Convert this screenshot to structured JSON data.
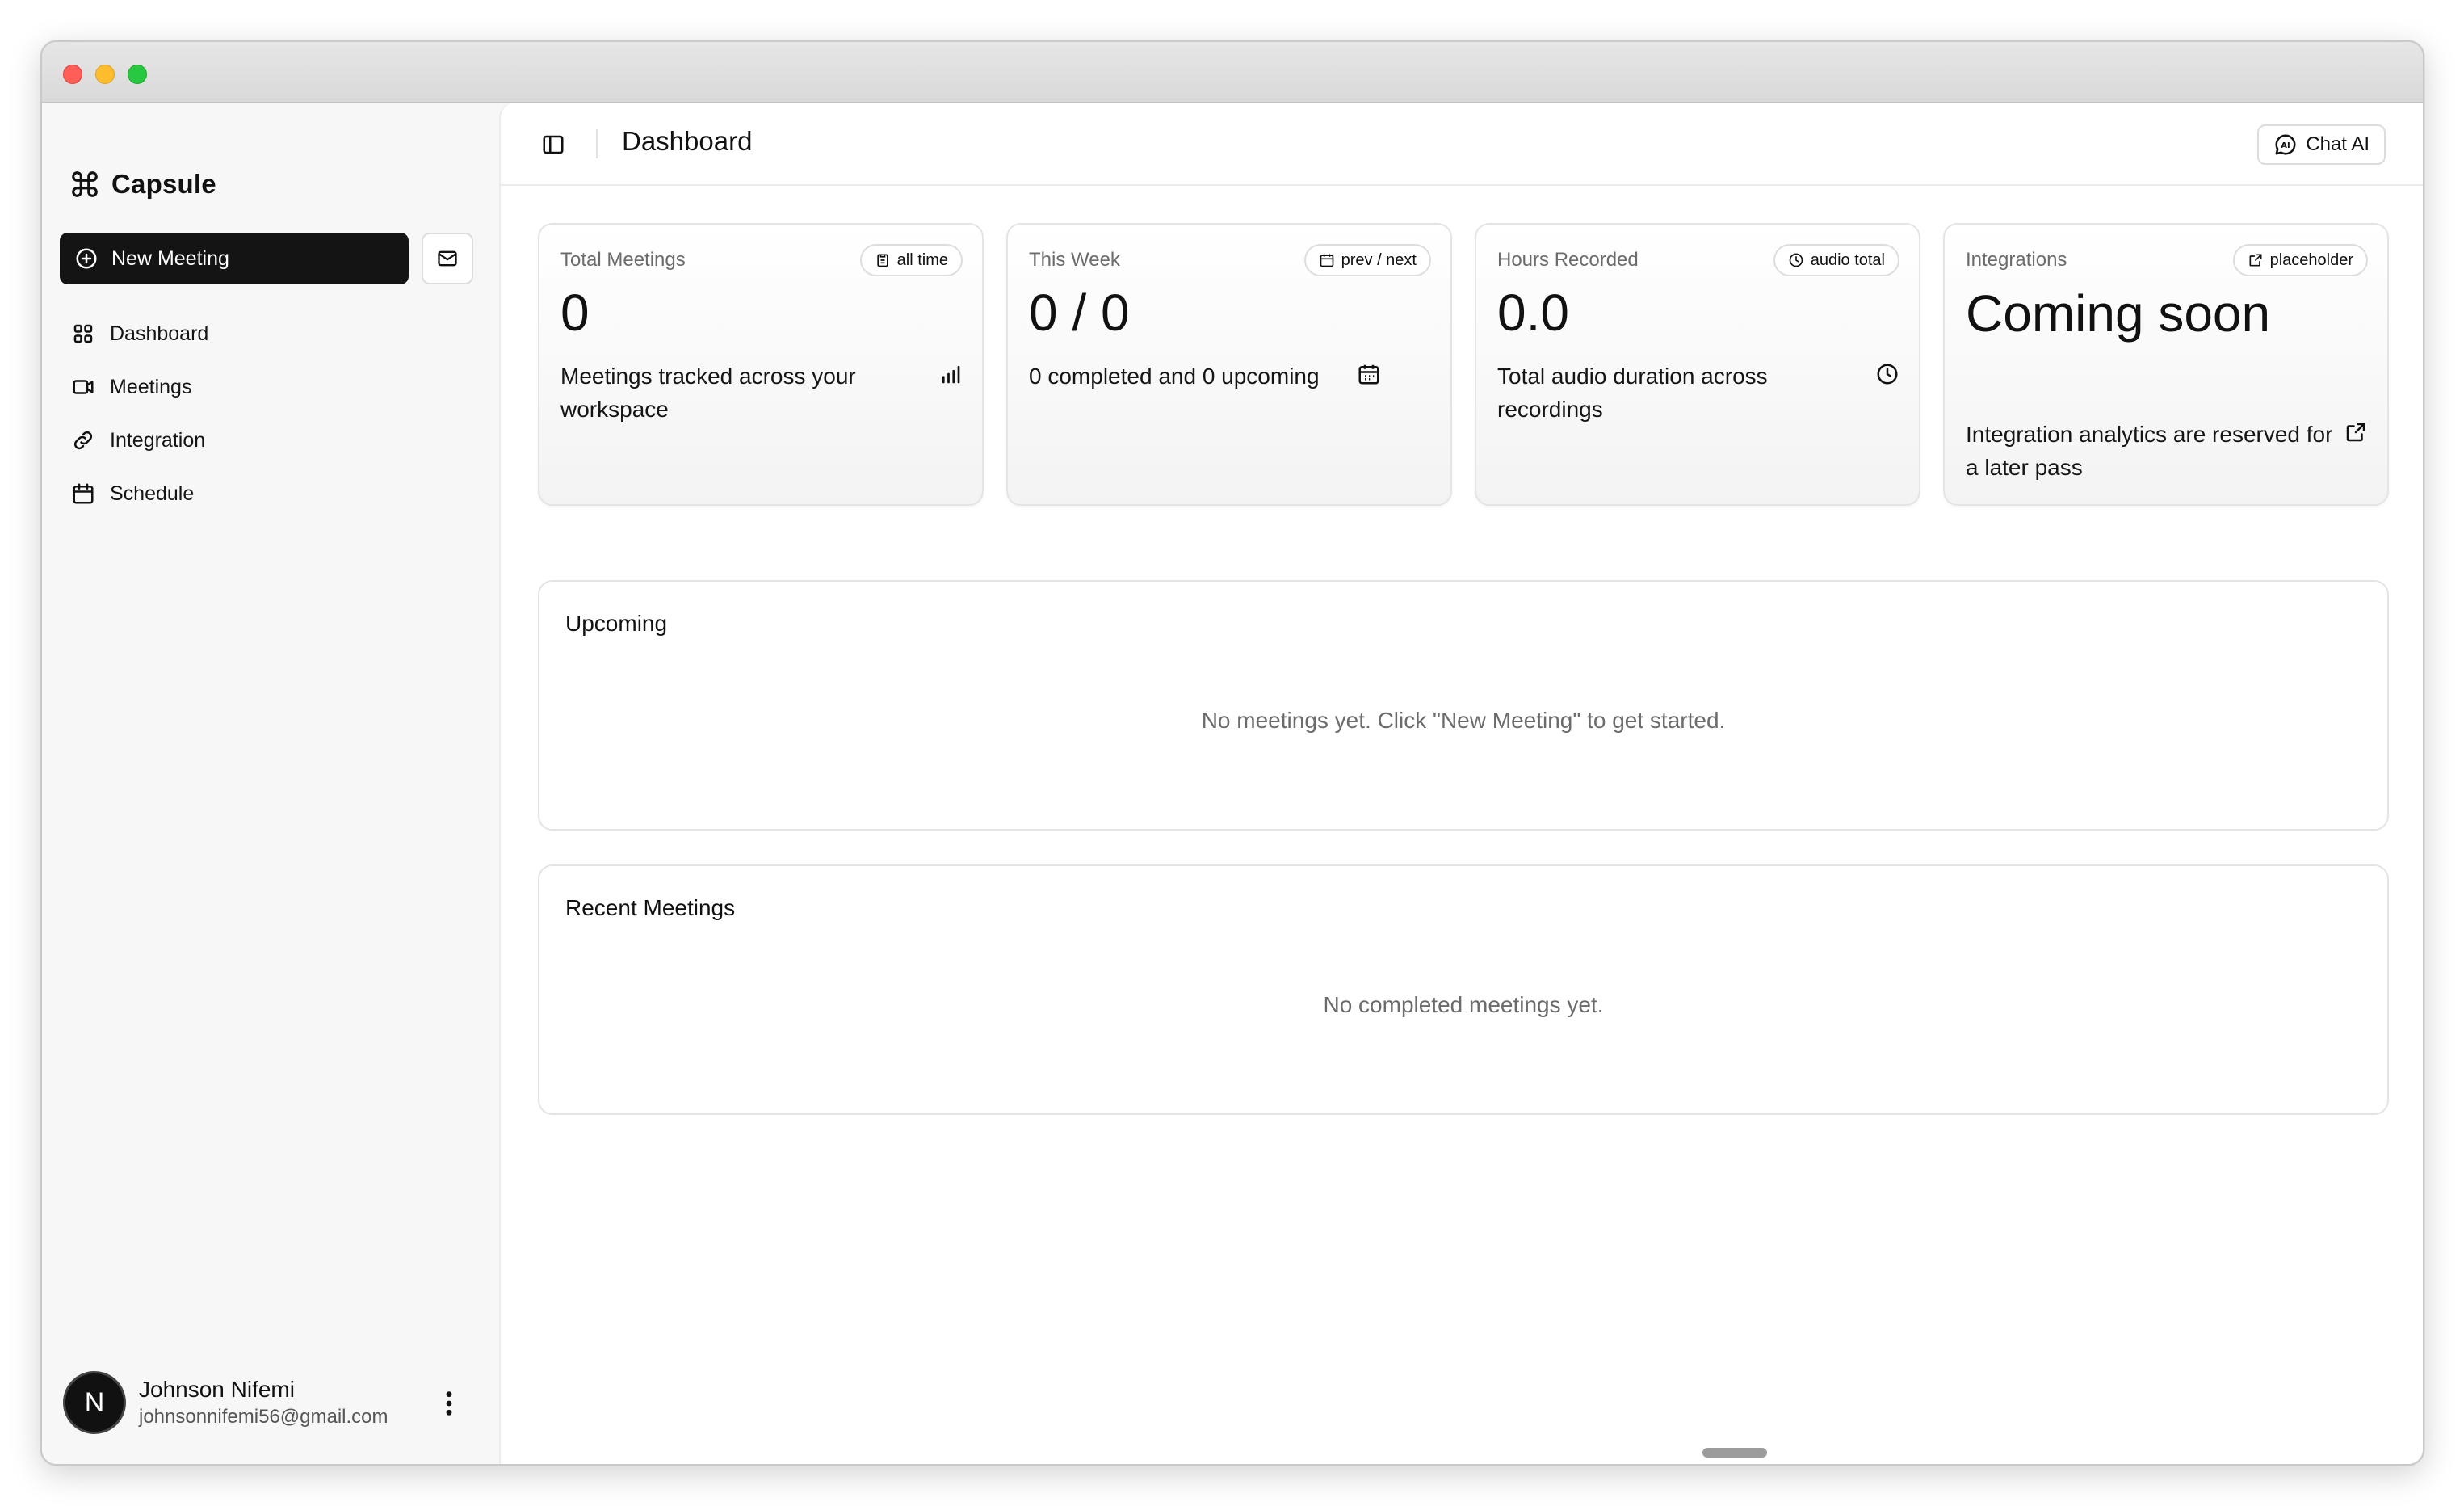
{
  "app": {
    "name": "Capsule"
  },
  "sidebar": {
    "new_meeting_label": "New Meeting",
    "items": [
      {
        "label": "Dashboard",
        "icon": "grid-icon"
      },
      {
        "label": "Meetings",
        "icon": "video-icon"
      },
      {
        "label": "Integration",
        "icon": "link-icon"
      },
      {
        "label": "Schedule",
        "icon": "calendar-icon"
      }
    ],
    "user": {
      "initial": "N",
      "name": "Johnson Nifemi",
      "email": "johnsonnifemi56@gmail.com"
    }
  },
  "header": {
    "title": "Dashboard",
    "chat_label": "Chat AI"
  },
  "cards": [
    {
      "label": "Total Meetings",
      "badge": "all time",
      "badge_icon": "clipboard-icon",
      "value": "0",
      "description": "Meetings tracked across your workspace",
      "desc_icon": "bar-chart-icon"
    },
    {
      "label": "This Week",
      "badge": "prev / next",
      "badge_icon": "calendar-icon",
      "value": "0 / 0",
      "description": "0 completed and 0 upcoming",
      "desc_icon": "calendar-icon"
    },
    {
      "label": "Hours Recorded",
      "badge": "audio total",
      "badge_icon": "clock-icon",
      "value": "0.0",
      "description": "Total audio duration across recordings",
      "desc_icon": "clock-icon"
    },
    {
      "label": "Integrations",
      "badge": "placeholder",
      "badge_icon": "external-link-icon",
      "value": "Coming soon",
      "description": "Integration analytics are reserved for a later pass",
      "desc_icon": "external-link-icon"
    }
  ],
  "upcoming": {
    "title": "Upcoming",
    "empty_text": "No meetings yet. Click \"New Meeting\" to get started."
  },
  "recent": {
    "title": "Recent Meetings",
    "empty_text": "No completed meetings yet."
  }
}
